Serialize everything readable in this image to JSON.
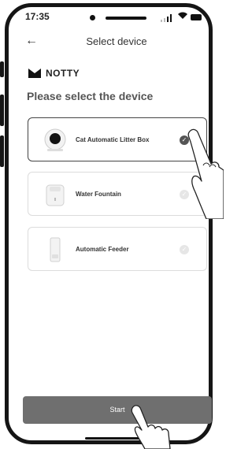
{
  "status": {
    "time": "17:35"
  },
  "header": {
    "back_icon": "arrow-left-icon",
    "title": "Select device"
  },
  "brand": {
    "name": "NOTTY",
    "icon": "notty-logo-icon"
  },
  "heading": "Please select the device",
  "devices": [
    {
      "label": "Cat Automatic Litter Box",
      "selected": true,
      "icon": "litter-box-icon"
    },
    {
      "label": "Water Fountain",
      "selected": false,
      "icon": "water-fountain-icon"
    },
    {
      "label": "Automatic Feeder",
      "selected": false,
      "icon": "feeder-icon"
    }
  ],
  "start_label": "Start",
  "colors": {
    "selected_check": "#555555",
    "unselected_check": "#e6e6e6",
    "start_button": "#6f6f6f"
  }
}
